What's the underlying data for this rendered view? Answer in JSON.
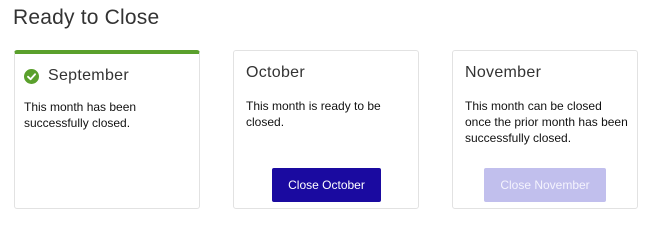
{
  "page": {
    "title": "Ready to Close"
  },
  "colors": {
    "completed_accent": "#5aa02c",
    "primary_button": "#1a0aa0",
    "disabled_button": "#c1bfed"
  },
  "cards": [
    {
      "month": "September",
      "status": "closed",
      "icon": "check-circle-icon",
      "description": "This month has been successfully closed."
    },
    {
      "month": "October",
      "status": "ready",
      "description": "This month is ready to be closed.",
      "button_label": "Close October"
    },
    {
      "month": "November",
      "status": "blocked",
      "description": "This month can be closed once the prior month has been successfully closed.",
      "button_label": "Close November"
    }
  ]
}
